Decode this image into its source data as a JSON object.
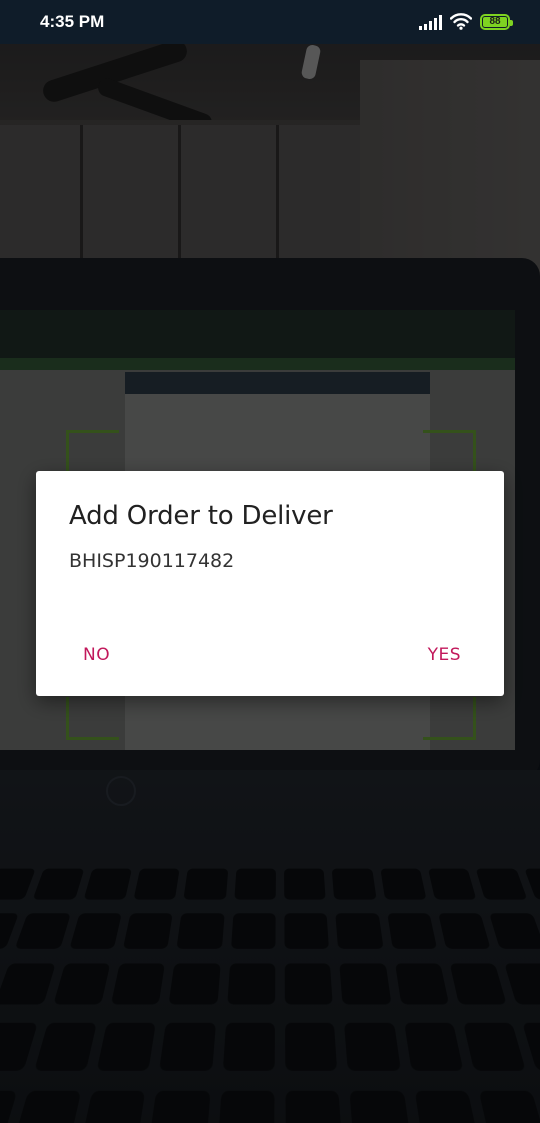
{
  "status_bar": {
    "time": "4:35 PM",
    "battery_level": "88",
    "battery_color": "#7ED321",
    "icons": [
      "signal-icon",
      "wifi-icon",
      "battery-icon"
    ]
  },
  "dialog": {
    "title": "Add Order to Deliver",
    "message": "BHISP190117482",
    "negative_label": "NO",
    "positive_label": "YES",
    "button_color": "#C2185B"
  },
  "background": {
    "description_icon": "camera-preview",
    "scan_frame_color": "#7CC042"
  }
}
